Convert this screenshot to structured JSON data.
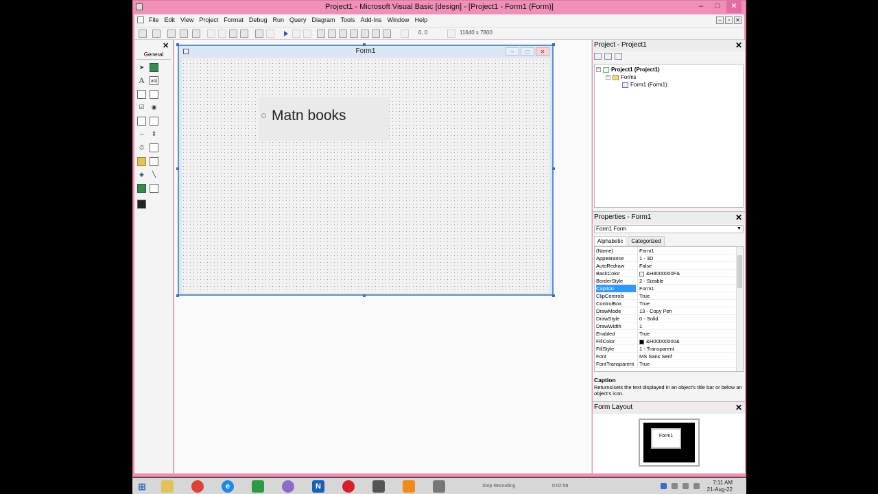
{
  "window": {
    "title": "Project1 - Microsoft Visual Basic [design] - [Project1 - Form1 (Form)]",
    "controls": [
      "–",
      "□",
      "✕"
    ]
  },
  "menu": [
    "File",
    "Edit",
    "View",
    "Project",
    "Format",
    "Debug",
    "Run",
    "Query",
    "Diagram",
    "Tools",
    "Add-Ins",
    "Window",
    "Help"
  ],
  "toolbar": {
    "position": "0, 0",
    "size": "11640 x 7800"
  },
  "toolbox": {
    "title": "General",
    "close": "✕",
    "pointer": "➤",
    "label_tool": "A",
    "textbox_tool": "ab|"
  },
  "form": {
    "title": "Form1",
    "buttons": [
      "–",
      "□",
      "✕"
    ],
    "label_text": "Matn books"
  },
  "project_panel": {
    "title": "Project - Project1",
    "close": "✕",
    "tree": [
      "Project1 (Project1)",
      "Forms",
      "Form1 (Form1)"
    ]
  },
  "properties_panel": {
    "title": "Properties - Form1",
    "close": "✕",
    "object": "Form1  Form",
    "tabs": [
      "Alphabetic",
      "Categorized"
    ],
    "rows": [
      {
        "name": "(Name)",
        "value": "Form1"
      },
      {
        "name": "Appearance",
        "value": "1 - 3D"
      },
      {
        "name": "AutoRedraw",
        "value": "False"
      },
      {
        "name": "BackColor",
        "value": "&H8000000F&"
      },
      {
        "name": "BorderStyle",
        "value": "2 - Sizable"
      },
      {
        "name": "Caption",
        "value": "Form1"
      },
      {
        "name": "ClipControls",
        "value": "True"
      },
      {
        "name": "ControlBox",
        "value": "True"
      },
      {
        "name": "DrawMode",
        "value": "13 - Copy Pen"
      },
      {
        "name": "DrawStyle",
        "value": "0 - Solid"
      },
      {
        "name": "DrawWidth",
        "value": "1"
      },
      {
        "name": "Enabled",
        "value": "True"
      },
      {
        "name": "FillColor",
        "value": "&H00000000&"
      },
      {
        "name": "FillStyle",
        "value": "1 - Transparent"
      },
      {
        "name": "Font",
        "value": "MS Sans Serif"
      },
      {
        "name": "FontTransparent",
        "value": "True"
      }
    ],
    "selected_row": "Caption",
    "desc_title": "Caption",
    "desc_text": "Returns/sets the text displayed in an object's title bar or below an object's icon."
  },
  "layout_panel": {
    "title": "Form Layout",
    "close": "✕",
    "mini_form": "Form1"
  },
  "taskbar": {
    "recording": "Stop Recording",
    "rec_time": "0:02:58",
    "time": "7:11 AM",
    "date": "21-Aug-22"
  }
}
